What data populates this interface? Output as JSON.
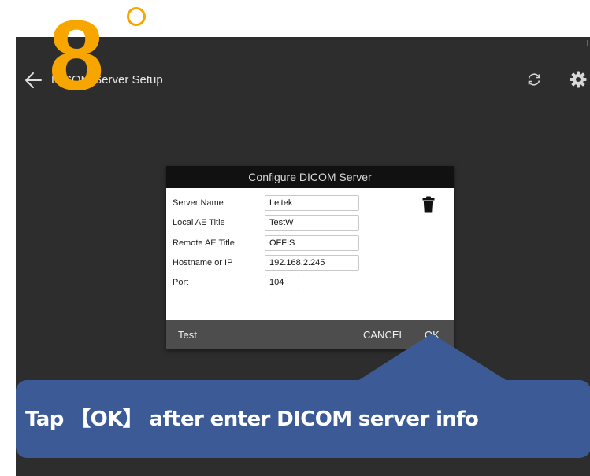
{
  "step": {
    "number": "8",
    "degree_mark": "circle"
  },
  "appbar": {
    "title": "DICOM Server Setup",
    "back_icon": "arrow-left-icon",
    "refresh_icon": "refresh-icon",
    "settings_icon": "gear-icon"
  },
  "dialog": {
    "title": "Configure DICOM Server",
    "fields": [
      {
        "label": "Server Name",
        "value": "Leltek"
      },
      {
        "label": "Local AE Title",
        "value": "TestW"
      },
      {
        "label": "Remote AE Title",
        "value": "OFFIS"
      },
      {
        "label": "Hostname or IP",
        "value": "192.168.2.245"
      },
      {
        "label": "Port",
        "value": "104"
      }
    ],
    "delete_icon": "trash-icon",
    "buttons": {
      "test": "Test",
      "cancel": "CANCEL",
      "ok": "OK"
    }
  },
  "callout": {
    "text": "Tap 【OK】 after enter DICOM server info"
  },
  "colors": {
    "step_accent": "#f7a600",
    "screen_bg": "#2d2d2d",
    "callout_bg": "#3b5a96",
    "dialog_header": "#111111",
    "dialog_footer": "#4d4d4d"
  }
}
